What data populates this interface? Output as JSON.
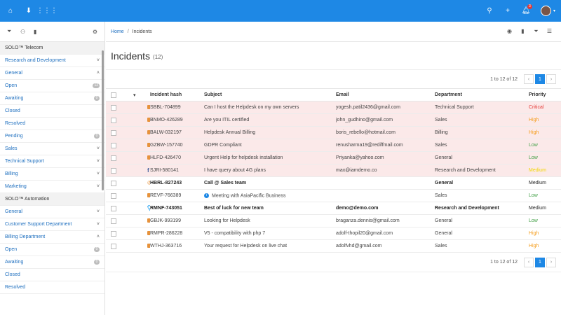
{
  "topbar": {
    "left_icons": [
      "home-icon",
      "download-icon",
      "apps-grid-icon"
    ],
    "right_icons": [
      "search-icon",
      "plus-icon",
      "bell-icon"
    ],
    "notification_count": "3",
    "colors": {
      "bar": "#1e88e5"
    }
  },
  "sidebar": {
    "tools": [
      "filter-icon",
      "hierarchy-icon",
      "bookmark-icon",
      "gear-icon"
    ],
    "rows": [
      {
        "label": "SOLO™ Telecom",
        "kind": "head"
      },
      {
        "label": "Research and Development",
        "kind": "link",
        "chevron": "down"
      },
      {
        "label": "General",
        "kind": "link",
        "chevron": "up"
      },
      {
        "label": "Open",
        "kind": "link",
        "count": "12"
      },
      {
        "label": "Awaiting",
        "kind": "link",
        "count": "0"
      },
      {
        "label": "Closed",
        "kind": "link"
      },
      {
        "label": "Resolved",
        "kind": "link"
      },
      {
        "label": "Pending",
        "kind": "link",
        "count": "0"
      },
      {
        "label": "Sales",
        "kind": "link",
        "chevron": "down"
      },
      {
        "label": "Technical Support",
        "kind": "link",
        "chevron": "down"
      },
      {
        "label": "Billing",
        "kind": "link",
        "chevron": "down"
      },
      {
        "label": "Marketing",
        "kind": "link",
        "chevron": "down"
      },
      {
        "label": "SOLO™ Automation",
        "kind": "head"
      },
      {
        "label": "General",
        "kind": "link",
        "chevron": "down"
      },
      {
        "label": "Customer Support Department",
        "kind": "link",
        "chevron": "down"
      },
      {
        "label": "Billing Department",
        "kind": "link",
        "chevron": "up"
      },
      {
        "label": "Open",
        "kind": "link",
        "count": "0"
      },
      {
        "label": "Awaiting",
        "kind": "link",
        "count": "0"
      },
      {
        "label": "Closed",
        "kind": "link"
      },
      {
        "label": "Resolved",
        "kind": "link"
      }
    ]
  },
  "breadcrumb": {
    "home": "Home",
    "sep": "/",
    "current": "Incidents"
  },
  "header_tools": [
    "eye-icon",
    "bookmark-icon",
    "filter-icon",
    "menu-icon"
  ],
  "page": {
    "title": "Incidents",
    "count": "(12)"
  },
  "pager": {
    "range": "1 to 12 of 12",
    "prev": "‹",
    "page": "1",
    "next": "›"
  },
  "table": {
    "columns": [
      "Incident hash",
      "Subject",
      "Email",
      "Department",
      "Priority"
    ],
    "rows": [
      {
        "channel": "mail",
        "hash": "SBBL-704899",
        "subject": "Can I host the Helpdesk on my own servers",
        "email": "yogesh.patil2436@gmail.com",
        "department": "Technical Support",
        "priority": "Critical",
        "pclass": "critical",
        "style": "pink"
      },
      {
        "channel": "mail",
        "hash": "BNMO-426289",
        "subject": "Are you ITIL certified",
        "email": "john_gudhino@gmail.com",
        "department": "Sales",
        "priority": "High",
        "pclass": "high",
        "style": "pink"
      },
      {
        "channel": "mail",
        "hash": "BALW-032197",
        "subject": "Helpdesk Annual Billing",
        "email": "boris_rebello@hotmail.com",
        "department": "Billing",
        "priority": "High",
        "pclass": "high",
        "style": "pink"
      },
      {
        "channel": "mail",
        "hash": "GZBW-157740",
        "subject": "GDPR Compliant",
        "email": "renusharma19@rediffmail.com",
        "department": "Sales",
        "priority": "Low",
        "pclass": "low",
        "style": "pink"
      },
      {
        "channel": "mail",
        "hash": "HLFD-426470",
        "subject": "Urgent Help for helpdesk installation",
        "email": "Priyanka@yahoo.com",
        "department": "General",
        "priority": "Low",
        "pclass": "low",
        "style": "pink"
      },
      {
        "channel": "facebook",
        "hash": "SJRI-580141",
        "subject": "I have query about 4G plans",
        "email": "max@iamdemo.co",
        "department": "Research and Development",
        "priority": "Medium",
        "pclass": "medium",
        "style": "pink"
      },
      {
        "channel": "phone",
        "hash": "HBRL-827243",
        "subject": "Call @ Sales team",
        "email": "",
        "department": "General",
        "priority": "Medium",
        "pclass": "medium",
        "style": "bold"
      },
      {
        "channel": "mail",
        "hash": "REVF-766389",
        "subject": "Meeting with AsiaPacific Business",
        "email": "",
        "department": "Sales",
        "priority": "Low",
        "pclass": "low",
        "style": "normal",
        "info": true
      },
      {
        "channel": "twitter",
        "hash": "RMNF-743051",
        "subject": "Best of luck for new team",
        "email": "demo@demo.com",
        "department": "Research and Development",
        "priority": "Medium",
        "pclass": "medium",
        "style": "bold"
      },
      {
        "channel": "mail",
        "hash": "GBJK-993199",
        "subject": "Looking for Helpdesk",
        "email": "braganza.dennis@gmail.com",
        "department": "General",
        "priority": "Low",
        "pclass": "low",
        "style": "normal"
      },
      {
        "channel": "mail",
        "hash": "RMPR-286228",
        "subject": "V5 - compatibility with php 7",
        "email": "adolf-thopil20@gmail.com",
        "department": "General",
        "priority": "High",
        "pclass": "high",
        "style": "normal"
      },
      {
        "channel": "mail",
        "hash": "WTHJ-363716",
        "subject": "Your request for Helpdesk on live chat",
        "email": "adolfvhd@gmail.com",
        "department": "Sales",
        "priority": "High",
        "pclass": "high",
        "style": "normal"
      }
    ]
  }
}
